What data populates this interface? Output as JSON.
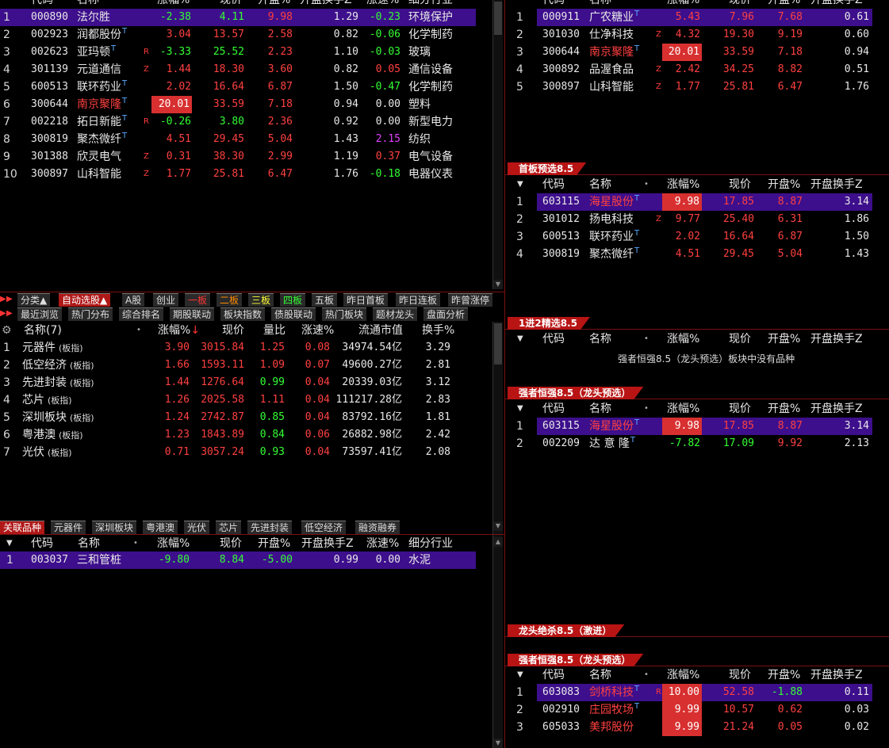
{
  "main_table": {
    "headers": [
      "代码",
      "名称",
      "涨幅%",
      "现价",
      "开盘%",
      "开盘换手Z",
      "涨速%",
      "细分行业"
    ],
    "rows": [
      {
        "idx": "1",
        "code": "000890",
        "name": "法尔胜",
        "t": "",
        "flag": "",
        "chg": "-2.38",
        "price": "4.11",
        "open": "9.98",
        "turn": "1.29",
        "speed": "-0.23",
        "ind": "环境保护"
      },
      {
        "idx": "2",
        "code": "002923",
        "name": "润都股份",
        "t": "T",
        "flag": "",
        "chg": "3.04",
        "price": "13.57",
        "open": "2.58",
        "turn": "0.82",
        "speed": "-0.06",
        "ind": "化学制药"
      },
      {
        "idx": "3",
        "code": "002623",
        "name": "亚玛顿",
        "t": "T",
        "flag": "R",
        "chg": "-3.33",
        "price": "25.52",
        "open": "2.23",
        "turn": "1.10",
        "speed": "-0.03",
        "ind": "玻璃"
      },
      {
        "idx": "4",
        "code": "301139",
        "name": "元道通信",
        "t": "",
        "flag": "Z",
        "chg": "1.44",
        "price": "18.30",
        "open": "3.60",
        "turn": "0.82",
        "speed": "0.05",
        "ind": "通信设备"
      },
      {
        "idx": "5",
        "code": "600513",
        "name": "联环药业",
        "t": "T",
        "flag": "",
        "chg": "2.02",
        "price": "16.64",
        "open": "6.87",
        "turn": "1.50",
        "speed": "-0.47",
        "ind": "化学制药"
      },
      {
        "idx": "6",
        "code": "300644",
        "name": "南京聚隆",
        "t": "T",
        "flag": "",
        "chg": "20.01",
        "price": "33.59",
        "open": "7.18",
        "turn": "0.94",
        "speed": "0.00",
        "ind": "塑料"
      },
      {
        "idx": "7",
        "code": "002218",
        "name": "拓日新能",
        "t": "T",
        "flag": "R",
        "chg": "-0.26",
        "price": "3.80",
        "open": "2.36",
        "turn": "0.92",
        "speed": "0.00",
        "ind": "新型电力"
      },
      {
        "idx": "8",
        "code": "300819",
        "name": "聚杰微纤",
        "t": "T",
        "flag": "",
        "chg": "4.51",
        "price": "29.45",
        "open": "5.04",
        "turn": "1.43",
        "speed": "2.15",
        "ind": "纺织"
      },
      {
        "idx": "9",
        "code": "301388",
        "name": "欣灵电气",
        "t": "",
        "flag": "Z",
        "chg": "0.31",
        "price": "38.30",
        "open": "2.99",
        "turn": "1.19",
        "speed": "0.37",
        "ind": "电气设备"
      },
      {
        "idx": "10",
        "code": "300897",
        "name": "山科智能",
        "t": "",
        "flag": "Z",
        "chg": "1.77",
        "price": "25.81",
        "open": "6.47",
        "turn": "1.76",
        "speed": "-0.18",
        "ind": "电器仪表"
      }
    ]
  },
  "tabs_row1": [
    "分类▲",
    "自动选股▲",
    "A股",
    "创业",
    "一板",
    "二板",
    "三板",
    "四板",
    "五板",
    "昨日首板",
    "昨日连板",
    "昨曾涨停"
  ],
  "tabs_row2": [
    "最近浏览",
    "热门分布",
    "综合排名",
    "期股联动",
    "板块指数",
    "债股联动",
    "热门板块",
    "题材龙头",
    "盘面分析"
  ],
  "sector_table": {
    "headers": [
      "名称(7)",
      "涨幅%",
      "现价",
      "量比",
      "涨速%",
      "流通市值",
      "换手%"
    ],
    "rows": [
      {
        "idx": "1",
        "name": "元器件",
        "tag": "(板指)",
        "chg": "3.90",
        "price": "3015.84",
        "vr": "1.25",
        "speed": "0.08",
        "cap": "34974.54亿",
        "turn": "3.29"
      },
      {
        "idx": "2",
        "name": "低空经济",
        "tag": "(板指)",
        "chg": "1.66",
        "price": "1593.11",
        "vr": "1.09",
        "speed": "0.07",
        "cap": "49600.27亿",
        "turn": "2.81"
      },
      {
        "idx": "3",
        "name": "先进封装",
        "tag": "(板指)",
        "chg": "1.44",
        "price": "1276.64",
        "vr": "0.99",
        "speed": "0.04",
        "cap": "20339.03亿",
        "turn": "3.12"
      },
      {
        "idx": "4",
        "name": "芯片",
        "tag": "(板指)",
        "chg": "1.26",
        "price": "2025.58",
        "vr": "1.11",
        "speed": "0.04",
        "cap": "111217.28亿",
        "turn": "2.83"
      },
      {
        "idx": "5",
        "name": "深圳板块",
        "tag": "(板指)",
        "chg": "1.24",
        "price": "2742.87",
        "vr": "0.85",
        "speed": "0.04",
        "cap": "83792.16亿",
        "turn": "1.81"
      },
      {
        "idx": "6",
        "name": "粤港澳",
        "tag": "(板指)",
        "chg": "1.23",
        "price": "1843.89",
        "vr": "0.84",
        "speed": "0.06",
        "cap": "26882.98亿",
        "turn": "2.42"
      },
      {
        "idx": "7",
        "name": "光伏",
        "tag": "(板指)",
        "chg": "0.71",
        "price": "3057.24",
        "vr": "0.93",
        "speed": "0.04",
        "cap": "73597.41亿",
        "turn": "2.08"
      }
    ]
  },
  "tabs_row3": [
    "关联品种",
    "元器件",
    "深圳板块",
    "粤港澳",
    "光伏",
    "芯片",
    "先进封装",
    "低空经济",
    "融资融券"
  ],
  "related_table": {
    "headers": [
      "代码",
      "名称",
      "涨幅%",
      "现价",
      "开盘%",
      "开盘换手Z",
      "涨速%",
      "细分行业"
    ],
    "rows": [
      {
        "idx": "1",
        "code": "003037",
        "name": "三和管桩",
        "chg": "-9.80",
        "price": "8.84",
        "open": "-5.00",
        "turn": "0.99",
        "speed": "0.00",
        "ind": "水泥"
      }
    ]
  },
  "right_top": {
    "headers": [
      "代码",
      "名称",
      "涨幅%",
      "现价",
      "开盘%",
      "开盘换手Z"
    ],
    "rows": [
      {
        "idx": "1",
        "code": "000911",
        "name": "广农糖业",
        "t": "T",
        "flag": "",
        "chg": "5.43",
        "price": "7.96",
        "open": "7.68",
        "turn": "0.61"
      },
      {
        "idx": "2",
        "code": "301030",
        "name": "仕净科技",
        "t": "",
        "flag": "Z",
        "chg": "4.32",
        "price": "19.30",
        "open": "9.19",
        "turn": "0.60"
      },
      {
        "idx": "3",
        "code": "300644",
        "name": "南京聚隆",
        "t": "T",
        "flag": "",
        "chg": "20.01",
        "price": "33.59",
        "open": "7.18",
        "turn": "0.94"
      },
      {
        "idx": "4",
        "code": "300892",
        "name": "品渥食品",
        "t": "",
        "flag": "Z",
        "chg": "2.42",
        "price": "34.25",
        "open": "8.82",
        "turn": "0.51"
      },
      {
        "idx": "5",
        "code": "300897",
        "name": "山科智能",
        "t": "",
        "flag": "Z",
        "chg": "1.77",
        "price": "25.81",
        "open": "6.47",
        "turn": "1.76"
      }
    ]
  },
  "panel_a": {
    "title": "首板预选8.5",
    "headers": [
      "代码",
      "名称",
      "涨幅%",
      "现价",
      "开盘%",
      "开盘换手Z"
    ],
    "rows": [
      {
        "idx": "1",
        "code": "603115",
        "name": "海星股份",
        "t": "T",
        "flag": "",
        "chg": "9.98",
        "price": "17.85",
        "open": "8.87",
        "turn": "3.14"
      },
      {
        "idx": "2",
        "code": "301012",
        "name": "扬电科技",
        "t": "",
        "flag": "Z",
        "chg": "9.77",
        "price": "25.40",
        "open": "6.31",
        "turn": "1.86"
      },
      {
        "idx": "3",
        "code": "600513",
        "name": "联环药业",
        "t": "T",
        "flag": "",
        "chg": "2.02",
        "price": "16.64",
        "open": "6.87",
        "turn": "1.50"
      },
      {
        "idx": "4",
        "code": "300819",
        "name": "聚杰微纤",
        "t": "T",
        "flag": "",
        "chg": "4.51",
        "price": "29.45",
        "open": "5.04",
        "turn": "1.43"
      }
    ]
  },
  "panel_b": {
    "title": "1进2精选8.5",
    "headers": [
      "代码",
      "名称",
      "涨幅%",
      "现价",
      "开盘%",
      "开盘换手Z"
    ],
    "empty_msg": "强者恒强8.5（龙头预选）板块中没有品种"
  },
  "panel_c": {
    "title": "强者恒强8.5（龙头预选）",
    "headers": [
      "代码",
      "名称",
      "涨幅%",
      "现价",
      "开盘%",
      "开盘换手Z"
    ],
    "rows": [
      {
        "idx": "1",
        "code": "603115",
        "name": "海星股份",
        "t": "T",
        "chg": "9.98",
        "price": "17.85",
        "open": "8.87",
        "turn": "3.14"
      },
      {
        "idx": "2",
        "code": "002209",
        "name": "达 意 隆",
        "t": "T",
        "chg": "-7.82",
        "price": "17.09",
        "open": "9.92",
        "turn": "2.13"
      }
    ]
  },
  "panel_d": {
    "title": "龙头绝杀8.5（激进）"
  },
  "panel_e": {
    "title": "强者恒强8.5（龙头预选）",
    "headers": [
      "代码",
      "名称",
      "涨幅%",
      "现价",
      "开盘%",
      "开盘换手Z"
    ],
    "rows": [
      {
        "idx": "1",
        "code": "603083",
        "name": "剑桥科技",
        "t": "T",
        "flag": "R",
        "chg": "10.00",
        "price": "52.58",
        "open": "-1.88",
        "turn": "0.11"
      },
      {
        "idx": "2",
        "code": "002910",
        "name": "庄园牧场",
        "t": "T",
        "flag": "",
        "chg": "9.99",
        "price": "10.57",
        "open": "0.62",
        "turn": "0.03"
      },
      {
        "idx": "3",
        "code": "605033",
        "name": "美邦股份",
        "t": "",
        "flag": "",
        "chg": "9.99",
        "price": "21.24",
        "open": "0.05",
        "turn": "0.02"
      }
    ]
  }
}
